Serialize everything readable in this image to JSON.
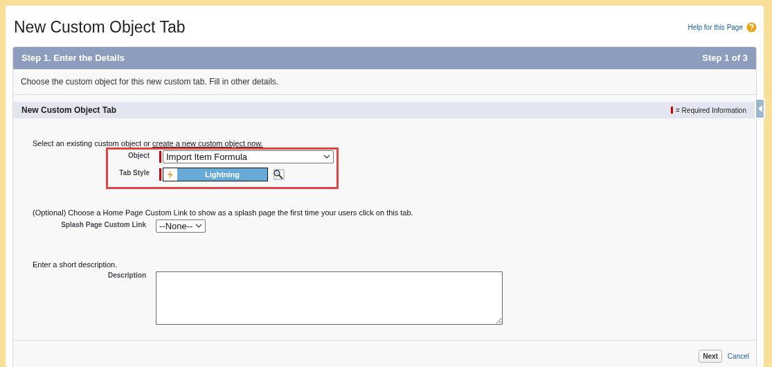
{
  "page_title": "New Custom Object Tab",
  "help_link": "Help for this Page",
  "step_bar": {
    "title": "Step 1. Enter the Details",
    "step": "Step 1 of 3"
  },
  "intro": "Choose the custom object for this new custom tab. Fill in other details.",
  "section": {
    "title": "New Custom Object Tab",
    "required_legend": "= Required Information"
  },
  "object_prompt": {
    "text": "Select an existing custom object or ",
    "link": "create a new custom object now."
  },
  "highlight": {
    "shown": true
  },
  "object_field": {
    "label": "Object",
    "value": "Import Item Formula",
    "required": true
  },
  "tab_style_field": {
    "label": "Tab Style",
    "value": "Lightning",
    "required": true
  },
  "splash_prompt": "(Optional) Choose a Home Page Custom Link to show as a splash page the first time your users click on this tab.",
  "splash_field": {
    "label": "Splash Page Custom Link",
    "value": "--None--"
  },
  "description_prompt": "Enter a short description.",
  "description_field": {
    "label": "Description"
  },
  "buttons": [
    {
      "label": "Next",
      "kind": "button"
    },
    {
      "label": "Cancel",
      "kind": "link"
    }
  ]
}
